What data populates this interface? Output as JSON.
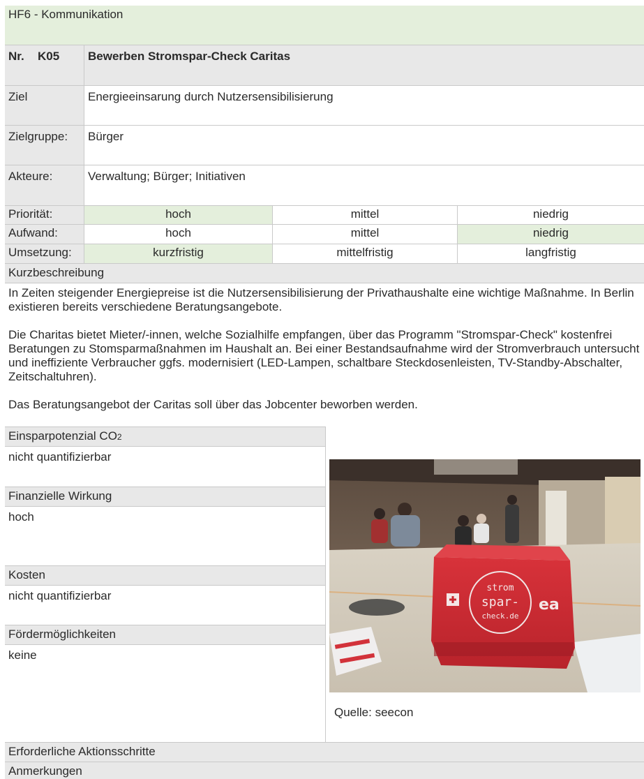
{
  "header": {
    "category": "HF6 - Kommunikation"
  },
  "measure": {
    "nr_label": "Nr.",
    "code": "K05",
    "title": "Bewerben Stromspar-Check Caritas"
  },
  "ziel": {
    "label": "Ziel",
    "value": "Energieeinsarung durch Nutzersensibilisierung"
  },
  "zielgruppe": {
    "label": "Zielgruppe:",
    "value": "Bürger"
  },
  "akteure": {
    "label": "Akteure:",
    "value": "Verwaltung; Bürger; Initiativen"
  },
  "prioritaet": {
    "label": "Priorität:",
    "options": [
      "hoch",
      "mittel",
      "niedrig"
    ],
    "selected": "hoch"
  },
  "aufwand": {
    "label": "Aufwand:",
    "options": [
      "hoch",
      "mittel",
      "niedrig"
    ],
    "selected": "niedrig"
  },
  "umsetzung": {
    "label": "Umsetzung:",
    "options": [
      "kurzfristig",
      "mittelfristig",
      "langfristig"
    ],
    "selected": "kurzfristig"
  },
  "kurzbeschreibung": {
    "label": "Kurzbeschreibung",
    "paragraphs": [
      "In Zeiten steigender Energiepreise ist die Nutzersensibilisierung der Privathaushalte eine wichtige Maßnahme. In Berlin existieren bereits verschiedene Beratungsangebote.",
      "Die Charitas bietet Mieter/-innen, welche Sozialhilfe empfangen, über das Programm \"Stromspar-Check\" kostenfrei Beratungen zu Stomsparmaßnahmen im Haushalt an. Bei einer Bestandsaufnahme wird der Stromverbrauch untersucht und ineffiziente Verbraucher ggfs. modernisiert (LED-Lampen, schaltbare Steckdosenleisten, TV-Standby-Abschalter, Zeitschaltuhren).",
      "Das Beratungsangebot der Caritas soll über das Jobcenter beworben werden."
    ]
  },
  "einsparpotenzial": {
    "label": "Einsparpotenzial CO",
    "label_sub": "2",
    "value": "nicht quantifizierbar"
  },
  "finanzielle_wirkung": {
    "label": "Finanzielle Wirkung",
    "value": "hoch"
  },
  "kosten": {
    "label": "Kosten",
    "value": "nicht quantifizierbar"
  },
  "foerdermoeglichkeiten": {
    "label": "Fördermöglichkeiten",
    "value": "keine"
  },
  "photo": {
    "bag_text_line1": "strom",
    "bag_text_line2": "spar-",
    "bag_text_line3": "check.de",
    "bag_logo": "ea",
    "caption": "Quelle: seecon"
  },
  "erforderliche_aktionsschritte": {
    "label": "Erforderliche Aktionsschritte"
  },
  "anmerkungen": {
    "label": "Anmerkungen"
  },
  "colors": {
    "highlight_green": "#e4efdc",
    "label_gray": "#e8e8e8",
    "bag_red": "#d22a32"
  }
}
